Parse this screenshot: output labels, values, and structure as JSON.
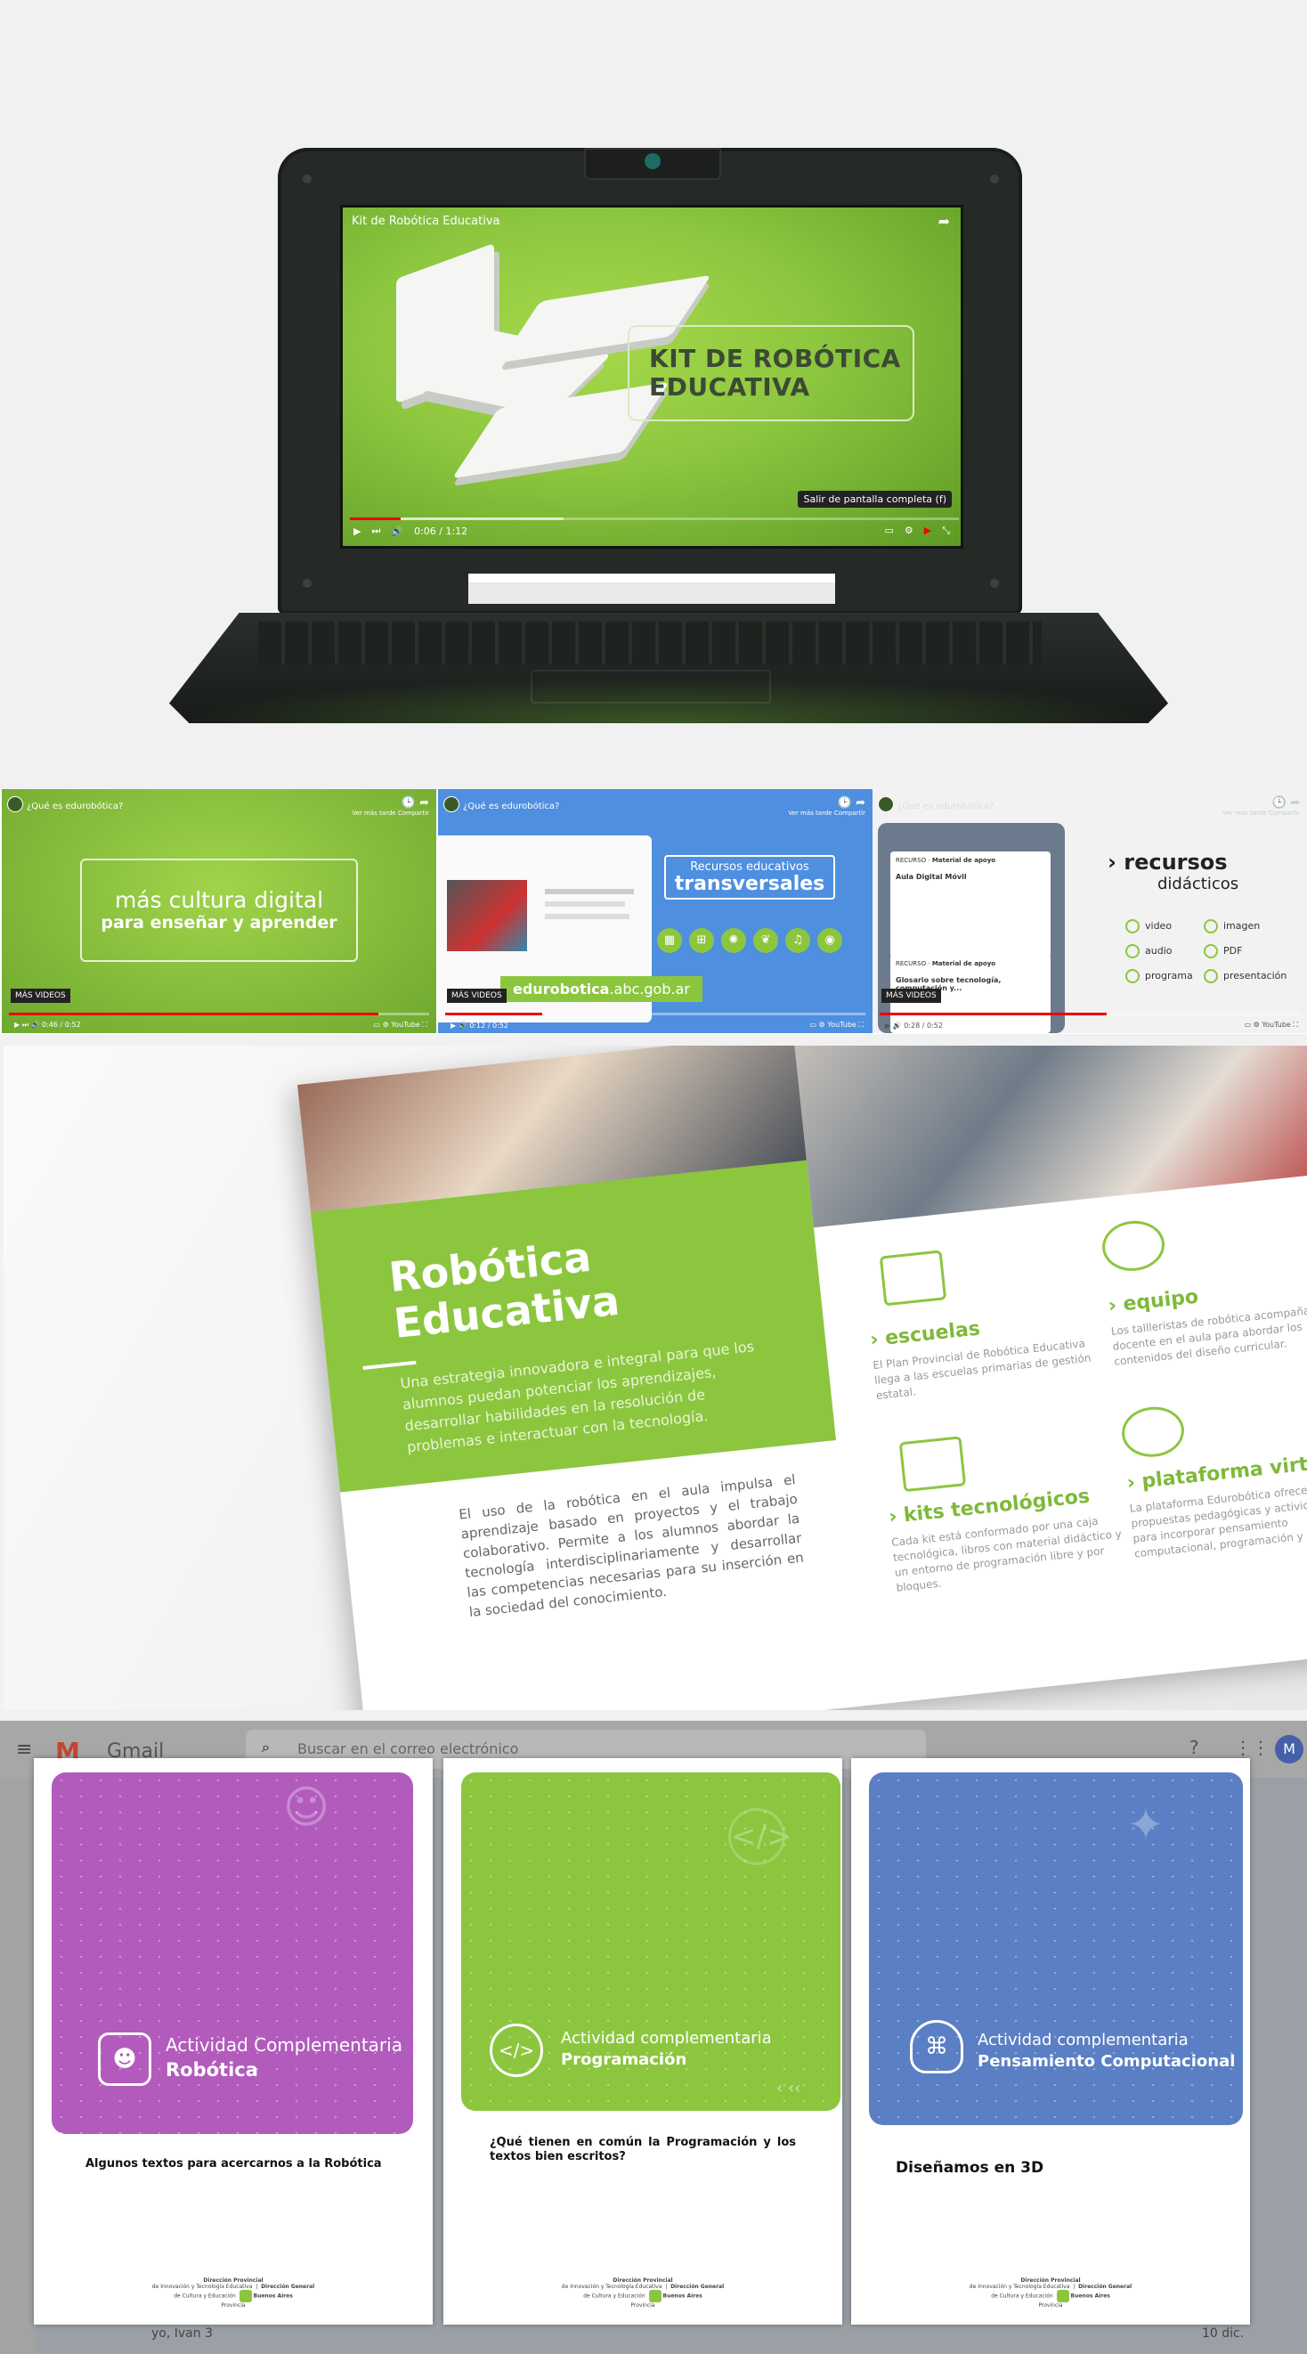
{
  "hero": {
    "video_title": "Kit de Robótica Educativa",
    "kit_line1": "KIT DE ROBÓTICA",
    "kit_line2": "EDUCATIVA",
    "tooltip": "Salir de pantalla completa (f)",
    "time": "0:06 / 1:12",
    "progress_fraction": 0.0833
  },
  "videos": [
    {
      "title": "¿Qué es edurobótica?",
      "line1": "más cultura digital",
      "line2": "para enseñar y aprender",
      "more": "MÁS VIDEOS",
      "time": "0:46 / 0:52",
      "progress_fraction": 0.88
    },
    {
      "title": "¿Qué es edurobótica?",
      "line1": "Recursos educativos",
      "line2": "transversales",
      "url_bold": "edurobotica",
      "url_rest": ".abc.gob.ar",
      "more": "MÁS VIDEOS",
      "time": "0:12 / 0:52",
      "progress_fraction": 0.23
    },
    {
      "title": "¿Qué es edurobótica?",
      "heading1": "recursos",
      "heading2": "didácticos",
      "more": "MÁS VIDEOS",
      "time": "0:28 / 0:52",
      "progress_fraction": 0.54,
      "card1_label": "RECURSO",
      "card1_tag": "Material de apoyo",
      "card1_title": "Aula Digital Móvil",
      "card2_label": "RECURSO",
      "card2_tag": "Material de apoyo",
      "card2_title": "Glosario sobre tecnología, computación y...",
      "resources": [
        "video",
        "imagen",
        "audio",
        "PDF",
        "programa",
        "presentación"
      ]
    }
  ],
  "video_common": {
    "later": "Ver más tarde",
    "share": "Compartir",
    "youtube": "YouTube"
  },
  "brochure": {
    "title1": "Robótica",
    "title2": "Educativa",
    "desc": "Una estrategia innovadora e integral para que los alumnos puedan potenciar los aprendizajes, desarrollar habilidades en la resolución de problemas e interactuar con la tecnología.",
    "body": "El uso de la robótica en el aula impulsa el aprendizaje basado en proyectos y el trabajo colaborativo. Permite a los alumnos abordar la tecnología interdisciplinariamente y desarrollar las competencias necesarias para su inserción en la sociedad del conocimiento.",
    "features": [
      {
        "title": "escuelas",
        "text": "El Plan Provincial de Robótica Educativa llega a las escuelas primarias de gestión estatal."
      },
      {
        "title": "equipo",
        "text": "Los tallleristas de robótica acompañan al docente en el aula para abordar los contenidos del diseño curricular."
      },
      {
        "title": "kits tecnológicos",
        "text": "Cada kit está conformado por una caja tecnológica, libros con material didáctico y un entorno de programación libre y por bloques."
      },
      {
        "title": "plataforma virtual",
        "text": "La plataforma Edurobótica ofrece propuestas pedagógicas y actividades para incorporar pensamiento computacional, programación y robótica."
      }
    ]
  },
  "gmail": {
    "brand": "Gmail",
    "search_placeholder": "Buscar en el correo electrónico",
    "avatar_letter": "M",
    "row_sender": "yo, Ivan 3",
    "row_date": "10 dic."
  },
  "cards": [
    {
      "label1": "Actividad Complementaria",
      "label2": "Robótica",
      "text": "Algunos textos para acercarnos a la Robótica",
      "color": "#b25bbd"
    },
    {
      "label1": "Actividad complementaria",
      "label2": "Programación",
      "text": "¿Qué tienen en común la Programación y los textos bien escritos?",
      "color": "#8cc63f"
    },
    {
      "label1": "Actividad complementaria",
      "label2": "Pensamiento Computacional",
      "text": "Diseñamos en 3D",
      "color": "#5b7fc4"
    }
  ],
  "card_footer": {
    "org1a": "Dirección Provincial",
    "org1b": "de Innovación y Tecnología Educativa",
    "org2a": "Dirección General",
    "org2b": "de Cultura y Educación",
    "gov_a": "Buenos Aires",
    "gov_b": "Provincia"
  },
  "colors": {
    "green": "#8cc63f",
    "purple": "#b25bbd",
    "blue": "#5b7fc4",
    "youtube_red": "#e00000"
  }
}
